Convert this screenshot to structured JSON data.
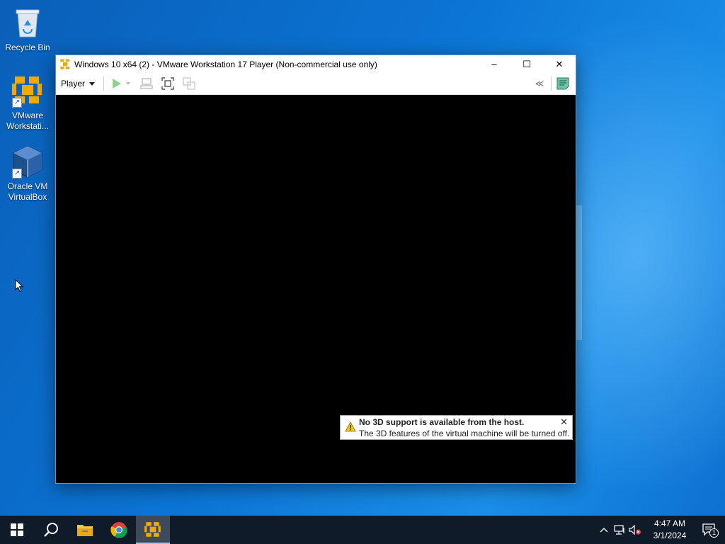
{
  "desktop": {
    "icons": [
      {
        "label": "Recycle Bin",
        "icon": "recycle-bin-icon"
      },
      {
        "label": "VMware Workstati...",
        "icon": "vmware-icon"
      },
      {
        "label": "Oracle VM VirtualBox",
        "icon": "virtualbox-icon"
      }
    ]
  },
  "window": {
    "title": "Windows 10 x64 (2) - VMware Workstation 17 Player (Non-commercial use only)",
    "controls": {
      "minimize": "–",
      "maximize": "☐",
      "close": "✕"
    },
    "toolbar": {
      "player_menu": "Player"
    },
    "notification": {
      "title": "No 3D support is available from the host.",
      "body": "The 3D features of the virtual machine will be turned off.",
      "close": "✕"
    }
  },
  "taskbar": {
    "items": [
      "start",
      "search",
      "file-explorer",
      "chrome",
      "vmware"
    ],
    "active": "vmware",
    "clock": {
      "time": "4:47 AM",
      "date": "3/1/2024"
    },
    "notifications_count": "1"
  },
  "colors": {
    "accent": "#0b74d4",
    "taskbar": "#101b2a",
    "vmware_orange": "#f2a900",
    "play_green": "#8fd28f"
  }
}
